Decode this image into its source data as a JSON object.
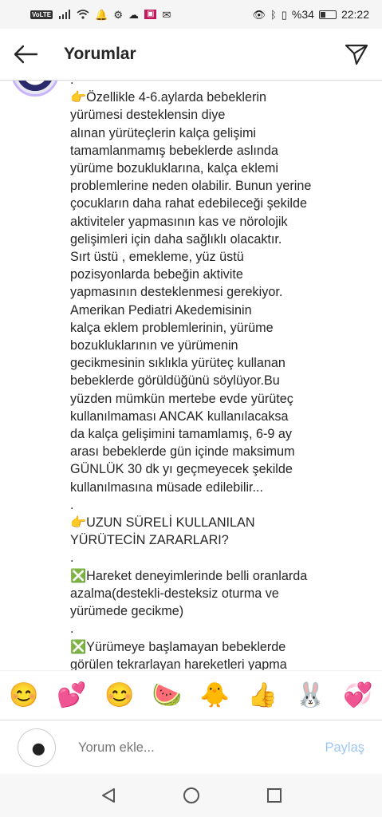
{
  "status_bar": {
    "network": "VoLTE",
    "battery": "%34",
    "battery_level": 0.34,
    "time": "22:22"
  },
  "header": {
    "title": "Yorumlar",
    "back_icon": "arrow-left-icon",
    "send_icon": "send-icon"
  },
  "comment": {
    "text": ".\n👉Özellikle 4-6.aylarda bebeklerin\nyürümesi desteklensin diye\nalınan yürüteçlerin kalça gelişimi\ntamamlanmamış bebeklerde aslında\nyürüme bozukluklarına, kalça eklemi\nproblemlerine neden olabilir. Bunun yerine\nçocukların daha rahat edebileceği şekilde\naktiviteler yapmasının kas ve nörolojik\ngelişimleri için daha sağlıklı olacaktır.\nSırt üstü , emekleme, yüz üstü\npozisyonlarda bebeğin aktivite\nyapmasının desteklenmesi gerekiyor.\nAmerikan Pediatri Akedemisinin\nkalça eklem problemlerinin, yürüme\nbozukluklarının ve yürümenin\ngecikmesinin sıklıkla yürüteç kullanan\nbebeklerde görüldüğünü söylüyor.Bu\nyüzden mümkün mertebe evde yürüteç\nkullanılmaması ANCAK kullanılacaksa\nda kalça gelişimini tamamlamış, 6-9 ay\narası bebeklerde gün içinde maksimum\nGÜNLÜK 30 dk yı geçmeyecek şekilde\nkullanılmasına müsade edilebilir...\n.\n👉UZUN SÜRELİ KULLANILAN\nYÜRÜTECİN ZARARLARI?\n.\n❎Hareket deneyimlerinde belli oranlarda\nazalma(destekli-desteksiz oturma ve\nyürümede gecikme)\n.\n❎Yürümeye başlamayan bebeklerde\ngörülen tekrarlayan hareketleri yapma\nda zorlanma(emeklemede zorlanma"
  },
  "emoji_bar": [
    {
      "char": "😊",
      "name": "smiling-face"
    },
    {
      "char": "💕",
      "name": "two-hearts"
    },
    {
      "char": "😊",
      "name": "smiling-face-2"
    },
    {
      "char": "🍉",
      "name": "watermelon"
    },
    {
      "char": "🐥",
      "name": "chick"
    },
    {
      "char": "👍",
      "name": "thumbs-up"
    },
    {
      "char": "🐰",
      "name": "rabbit"
    },
    {
      "char": "💞",
      "name": "revolving-hearts"
    }
  ],
  "input": {
    "placeholder": "Yorum ekle...",
    "share_label": "Paylaş"
  },
  "colors": {
    "share_disabled": "#9dc6f5",
    "divider": "#dbdbdb",
    "text": "#262626"
  }
}
